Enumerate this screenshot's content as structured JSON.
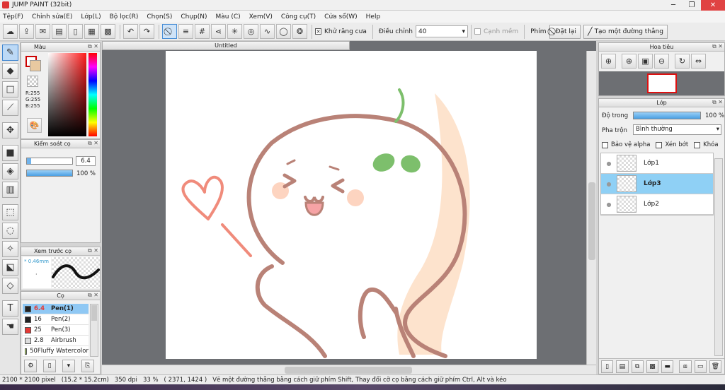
{
  "window": {
    "title": "JUMP PAINT (32bit)"
  },
  "menu": [
    "Tệp(F)",
    "Chỉnh sửa(E)",
    "Lớp(L)",
    "Bộ lọc(R)",
    "Chọn(S)",
    "Chụp(N)",
    "Màu (C)",
    "Xem(V)",
    "Công cụ(T)",
    "Cửa sổ(W)",
    "Help"
  ],
  "toolbar": {
    "antialias_label": "Khử răng cưa",
    "adjust_label": "Điều chỉnh",
    "adjust_value": "40",
    "smooth_label": "Cạnh mềm",
    "key_label": "Phím",
    "reset_label": "Đặt lại",
    "line_label": "Tạo một đường thẳng"
  },
  "color_panel": {
    "title": "Màu",
    "r": "R:255",
    "g": "G:255",
    "b": "B:255"
  },
  "brush_control": {
    "title": "Kiểm soát cọ",
    "size": "6.4",
    "opacity": "100 %"
  },
  "brush_preview": {
    "title": "Xem trước cọ",
    "size": "0.46mm"
  },
  "brushes": {
    "title": "Cọ",
    "items": [
      {
        "size": "6.4",
        "name": "Pen(1)",
        "color": "#222222",
        "selected": true
      },
      {
        "size": "16",
        "name": "Pen(2)",
        "color": "#222222",
        "selected": false
      },
      {
        "size": "25",
        "name": "Pen(3)",
        "color": "#e53935",
        "selected": false
      },
      {
        "size": "2.8",
        "name": "Airbrush",
        "color": "#dddddd",
        "selected": false
      },
      {
        "size": "50",
        "name": "Fluffy Watercolor",
        "color": "#b7e36b",
        "selected": false
      }
    ]
  },
  "document": {
    "tab": "Untitled"
  },
  "navigator": {
    "title": "Hoa tiêu"
  },
  "layers": {
    "title": "Lớp",
    "opacity_label": "Độ trong",
    "opacity_value": "100 %",
    "blend_label": "Pha trộn",
    "blend_value": "Bình thường",
    "protect_alpha": "Bảo vệ alpha",
    "clip": "Xén bớt",
    "lock": "Khóa",
    "items": [
      {
        "name": "Lớp1",
        "selected": false
      },
      {
        "name": "Lớp3",
        "selected": true
      },
      {
        "name": "Lớp2",
        "selected": false
      }
    ]
  },
  "status": {
    "size": "2100 * 2100 pixel",
    "cm": "(15.2 * 15.2cm)",
    "dpi": "350 dpi",
    "zoom": "33 %",
    "coords": "( 2371, 1424 )",
    "hint": "Vẽ một đường thẳng bằng cách giữ phím Shift, Thay đổi cỡ cọ bằng cách giữ phím Ctrl, Alt và kéo"
  },
  "colors": {
    "selection": "#8fc8f4",
    "accent": "#3c83cf",
    "canvas_bg": "#6d6f73"
  }
}
